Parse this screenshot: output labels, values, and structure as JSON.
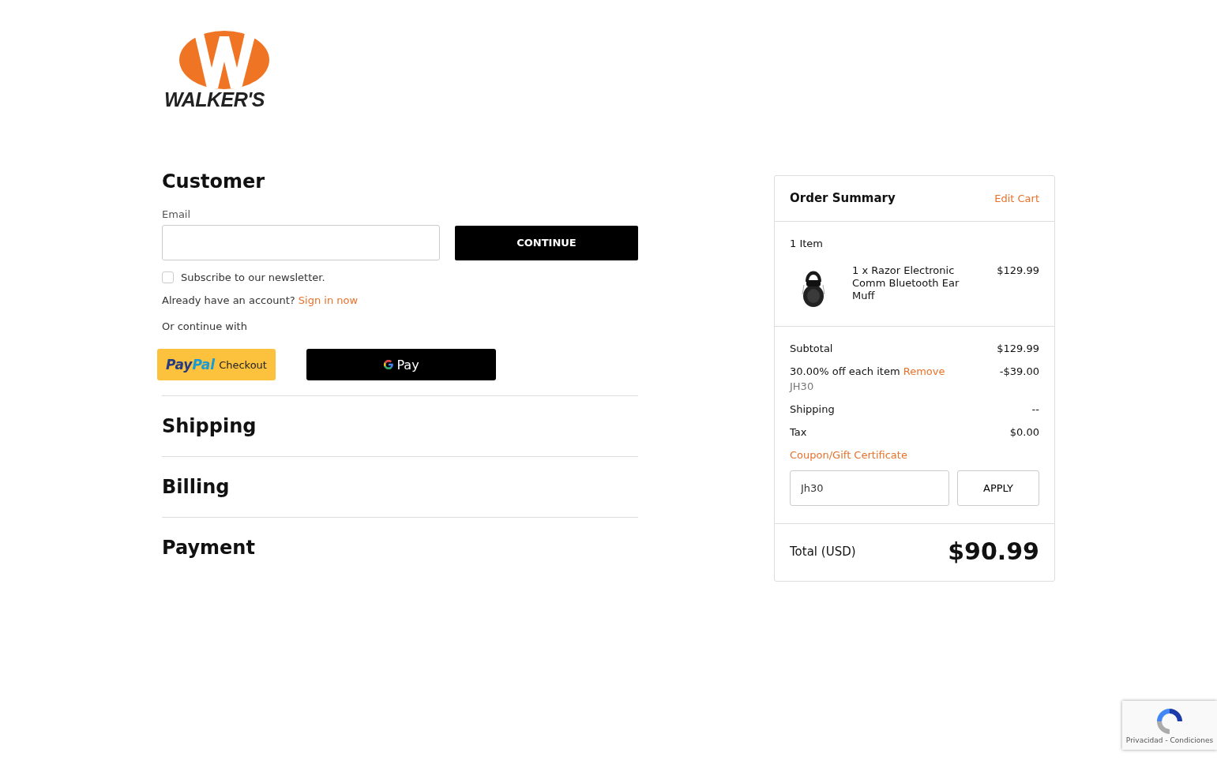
{
  "logo": {
    "wordmark": "WALKER'S"
  },
  "customer": {
    "heading": "Customer",
    "email_label": "Email",
    "continue_button": "CONTINUE",
    "newsletter": {
      "label": "Subscribe to our newsletter.",
      "checked": false
    },
    "account_prompt": "Already have an account?",
    "sign_in_link": "Sign in now",
    "alt_label": "Or continue with",
    "paypal": {
      "brand_pay": "Pay",
      "brand_pal": "Pal",
      "label": "Checkout"
    },
    "gpay": {
      "label": "Pay"
    }
  },
  "sections": [
    {
      "heading": "Shipping"
    },
    {
      "heading": "Billing"
    },
    {
      "heading": "Payment"
    }
  ],
  "order_summary": {
    "title": "Order Summary",
    "edit_link": "Edit Cart",
    "item_count": "1 Item",
    "items": [
      {
        "kind": "picture",
        "name": "1 x Razor Electronic Comm Bluetooth Ear Muff",
        "price": "$129.99"
      }
    ],
    "lines": [
      {
        "kind": "plain",
        "label": "Subtotal",
        "value": "$129.99"
      },
      {
        "kind": "discount",
        "label": "30.00% off each item",
        "action": "Remove",
        "code": "JH30",
        "value": "-$39.00"
      },
      {
        "kind": "plain",
        "label": "Shipping",
        "value": "--"
      },
      {
        "kind": "plain",
        "label": "Tax",
        "value": "$0.00"
      }
    ],
    "coupon_link": "Coupon/Gift Certificate",
    "coupon_value": "Jh30",
    "apply_button": "APPLY",
    "total_label": "Total (USD)",
    "total_value": "$90.99"
  },
  "recaptcha": {
    "footer": "Privacidad - Condiciones"
  }
}
